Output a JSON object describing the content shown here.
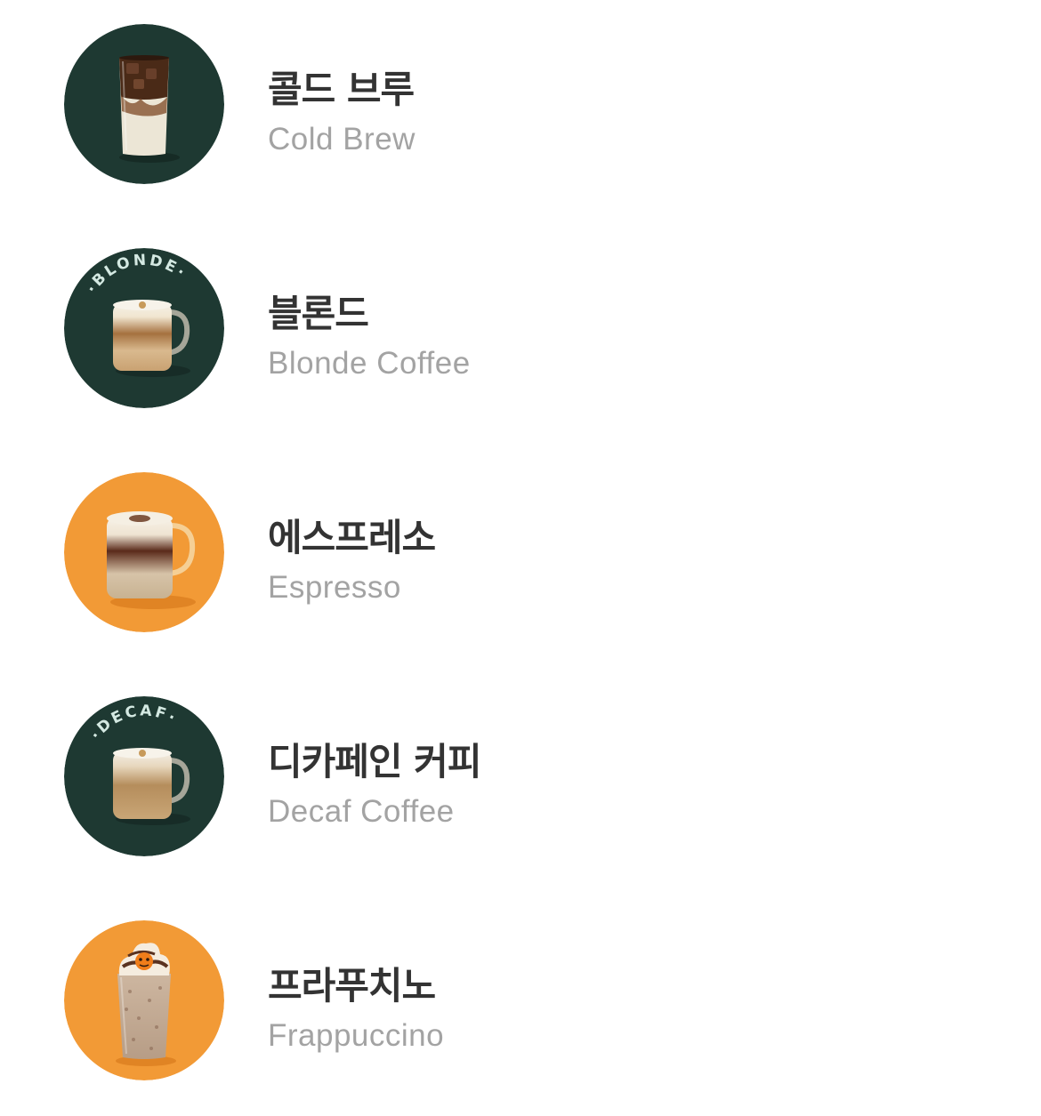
{
  "colors": {
    "green": "#1e3932",
    "orange": "#f29a36",
    "title": "#333333",
    "subtitle": "#a3a3a3"
  },
  "menu": {
    "items": [
      {
        "name_ko": "콜드 브루",
        "name_en": "Cold Brew",
        "bg": "green",
        "image": "cold-brew-glass-icon"
      },
      {
        "name_ko": "블론드",
        "name_en": "Blonde Coffee",
        "bg": "green",
        "badge": "BLONDE",
        "image": "blonde-mug-icon"
      },
      {
        "name_ko": "에스프레소",
        "name_en": "Espresso",
        "bg": "orange",
        "image": "espresso-mug-icon"
      },
      {
        "name_ko": "디카페인 커피",
        "name_en": "Decaf Coffee",
        "bg": "green",
        "badge": "DECAF",
        "image": "decaf-mug-icon"
      },
      {
        "name_ko": "프라푸치노",
        "name_en": "Frappuccino",
        "bg": "orange",
        "image": "frappuccino-cup-icon"
      }
    ]
  }
}
